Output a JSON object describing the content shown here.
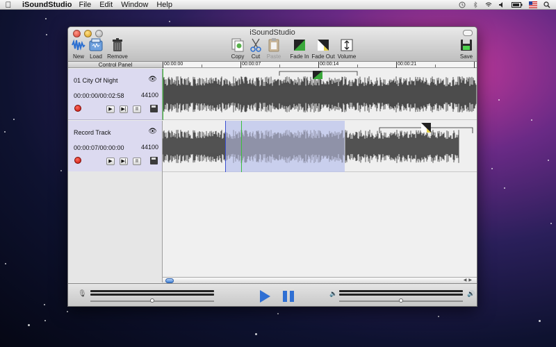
{
  "menubar": {
    "app_name": "iSoundStudio",
    "menus": [
      "File",
      "Edit",
      "Window",
      "Help"
    ],
    "status_icons": [
      "time-machine-icon",
      "bluetooth-icon",
      "wifi-icon",
      "volume-icon",
      "battery-icon",
      "flag-icon",
      "spotlight-icon"
    ]
  },
  "window": {
    "title": "iSoundStudio"
  },
  "toolbar": {
    "new_label": "New",
    "load_label": "Load",
    "remove_label": "Remove",
    "copy_label": "Copy",
    "cut_label": "Cut",
    "paste_label": "Paste",
    "fade_in_label": "Fade In",
    "fade_out_label": "Fade Out",
    "volume_label": "Volume",
    "save_label": "Save"
  },
  "control_panel": {
    "header": "Control Panel",
    "tracks": [
      {
        "name": "01 City Of Night",
        "time": "00:00:00/00:02:58",
        "sample_rate": "44100"
      },
      {
        "name": "Record Track",
        "time": "00:00:07/00:00:00",
        "sample_rate": "44100"
      }
    ]
  },
  "timeline": {
    "markers": [
      "00:00:00",
      "00:00:07",
      "00:00:14",
      "00:00:21"
    ]
  },
  "transport": {
    "input_level": 0.5,
    "output_level": 0.5
  },
  "colors": {
    "accent": "#2f6fd3",
    "track_panel": "#dcdaf0",
    "selection": "#a0aae1",
    "record": "#d0180c",
    "playhead_green": "#3bbf3b"
  }
}
